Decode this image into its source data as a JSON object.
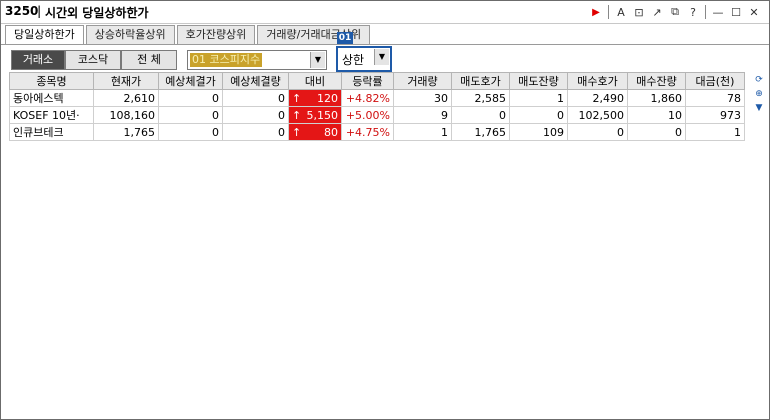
{
  "window": {
    "code": "3250",
    "separator": "|",
    "title": "시간외 당일상하한가",
    "icons": [
      "play-icon",
      "font-icon",
      "new-window-icon",
      "link-icon",
      "restore-window-icon",
      "help-icon",
      "minimize-icon",
      "maximize-icon",
      "close-icon"
    ],
    "icon_glyphs": [
      "▶",
      "A",
      "⊡",
      "↗",
      "⧉",
      "?",
      "—",
      "☐",
      "✕"
    ]
  },
  "tabs": [
    {
      "label": "당일상하한가",
      "active": true
    },
    {
      "label": "상승하락율상위",
      "active": false
    },
    {
      "label": "호가잔량상위",
      "active": false
    },
    {
      "label": "거래량/거래대금상위",
      "active": false
    }
  ],
  "market_segments": [
    {
      "label": "거래소",
      "active": true
    },
    {
      "label": "코스닥",
      "active": false
    },
    {
      "label": "전  체",
      "active": false
    }
  ],
  "index_select": {
    "value": "01 코스피지수"
  },
  "limit_select": {
    "badge": "01",
    "value": "상한"
  },
  "table": {
    "columns": [
      "종목명",
      "현재가",
      "예상체결가",
      "예상체결량",
      "대비",
      "등락률",
      "거래량",
      "매도호가",
      "매도잔량",
      "매수호가",
      "매수잔량",
      "대금(천)"
    ],
    "rows": [
      {
        "name": "동아에스텍",
        "price": "2,610",
        "exp_price": "0",
        "exp_vol": "0",
        "change_arrow": "↑",
        "change": "120",
        "rate": "+4.82%",
        "volume": "30",
        "ask": "2,585",
        "ask_qty": "1",
        "bid": "2,490",
        "bid_qty": "1,860",
        "amount": "78"
      },
      {
        "name": "KOSEF 10년·",
        "price": "108,160",
        "exp_price": "0",
        "exp_vol": "0",
        "change_arrow": "↑",
        "change": "5,150",
        "rate": "+5.00%",
        "volume": "9",
        "ask": "0",
        "ask_qty": "0",
        "bid": "102,500",
        "bid_qty": "10",
        "amount": "973"
      },
      {
        "name": "인큐브테크",
        "price": "1,765",
        "exp_price": "0",
        "exp_vol": "0",
        "change_arrow": "↑",
        "change": "80",
        "rate": "+4.75%",
        "volume": "1",
        "ask": "1,765",
        "ask_qty": "109",
        "bid": "0",
        "bid_qty": "0",
        "amount": "1"
      }
    ]
  },
  "side_controls": {
    "glyphs": [
      "⟳",
      "⊕",
      "▼"
    ]
  },
  "colors": {
    "accent": "#1e5aa8",
    "up_red": "#e41616",
    "combo_gold": "#c9a22a",
    "dark_segment": "#4a4a4a"
  }
}
